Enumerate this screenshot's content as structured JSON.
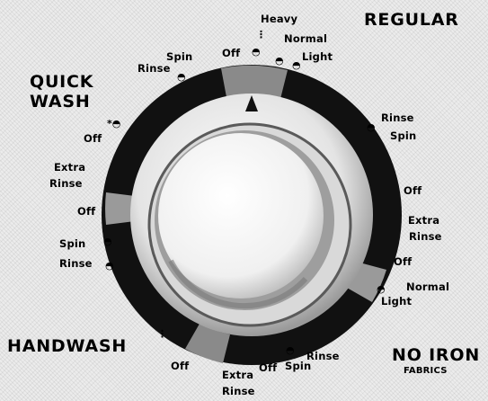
{
  "sections": {
    "regular": "REGULAR",
    "quick_wash_line1": "QUICK",
    "quick_wash_line2": "WASH",
    "handwash": "HANDWASH",
    "no_iron_line1": "NO IRON",
    "no_iron_line2": "FABRICS"
  },
  "settings": {
    "off_top": "Off",
    "heavy": "Heavy",
    "normal_top": "Normal",
    "light_top": "Light",
    "spin_top": "Spin",
    "rinse_top": "Rinse",
    "rinse_right": "Rinse",
    "spin_right": "Spin",
    "off_right1": "Off",
    "extra_right_line1": "Extra",
    "extra_right_line2": "Rinse",
    "off_right2": "Off",
    "normal_right": "Normal",
    "light_right": "Light",
    "rinse_bottom_right": "Rinse",
    "spin_bottom": "Spin",
    "off_bottom2": "Off",
    "extra_bottom_line1": "Extra",
    "extra_bottom_line2": "Rinse",
    "off_bottom1": "Off",
    "spin_left": "Spin",
    "rinse_left": "Rinse",
    "off_left2": "Off",
    "extra_left_line1": "Extra",
    "extra_left_line2": "Rinse",
    "off_left1": "Off"
  },
  "colors": {
    "ring_dark": "#111111",
    "knob_light": "#f2f2f2",
    "knob_mid": "#bdbdbd",
    "knob_shadow": "#6e6e6e"
  }
}
